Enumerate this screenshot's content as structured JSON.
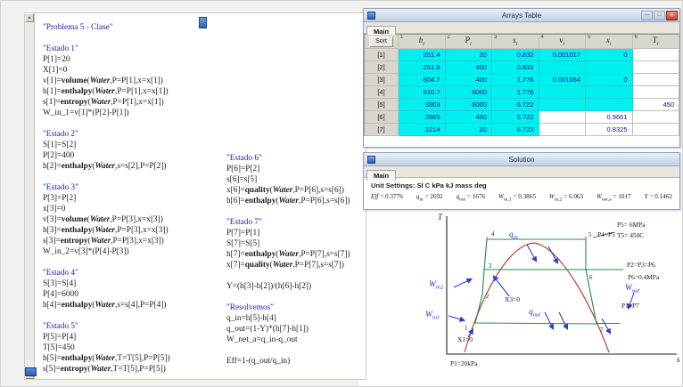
{
  "colors": {
    "cyan_cell": "#00efef",
    "titlebar": "#c3d0e2",
    "comment_text": "#2121b4",
    "value_text": "#10108e",
    "dome_red": "#c6403c",
    "cycle_green": "#1f8a4c",
    "annotation_blue": "#2b3fd4",
    "close_button": "#c73d2c"
  },
  "equations": {
    "bold_words": [
      "volume",
      "enthalpy",
      "entropy",
      "quality"
    ],
    "bold_italic_words": [
      "Water"
    ],
    "column1": [
      "\"Problema 5 - Clase\"",
      "",
      "\"Estado 1\"",
      "P[1]=20",
      "X[1]=0",
      "v[1]=volume(Water,P=P[1],x=x[1])",
      "h[1]=enthalpy(Water,P=P[1],x=x[1])",
      "s[1]=entropy(Water,P=P[1],x=x[1])",
      "W_in_1=v[1]*(P[2]-P[1])",
      "",
      "\"Estado 2\"",
      "S[1]=S[2]",
      "P[2]=400",
      "h[2]=enthalpy(Water,s=s[2],P=P[2])",
      "",
      "\"Estado 3\"",
      "P[3]=P[2]",
      "x[3]=0",
      "v[3]=volume(Water,P=P[3],x=x[3])",
      "h[3]=enthalpy(Water,P=P[3],x=x[3])",
      "s[3]=entropy(Water,P=P[3],x=x[3])",
      "W_in_2=v[3]*(P[4]-P[3])",
      "",
      "\"Estado 4\"",
      "S[3]=S[4]",
      "P[4]=6000",
      "h[4]=enthalpy(Water,s=s[4],P=P[4])",
      "",
      "\"Estado 5\"",
      "P[5]=P[4]",
      "T[5]=450",
      "h[5]=enthalpy(Water,T=T[5],P=P[5])",
      "s[5]=entropy(Water,T=T[5],P=P[5])"
    ],
    "column2": [
      "\"Estado 6\"",
      "P[6]=P[2]",
      "s[6]=s[5]",
      "x[6]=quality(Water,P=P[6],s=s[6])",
      "h[6]=enthalpy(Water,P=P[6],s=s[6])",
      "",
      "\"Estado 7\"",
      "P[7]=P[1]",
      "S[7]=S[5]",
      "h[7]=enthalpy(Water,P=P[7],s=s[7])",
      "x[7]=quality(Water,P=P[7],s=s[7])",
      "",
      "Y=(h[3]-h[2])/(h[6]-h[2])",
      "",
      "\"Resolvemos\"",
      "q_in=h[5]-h[4]",
      "q_out=(1-Y)*(h[7]-h[1])",
      "W_net_a=q_in-q_out",
      "",
      "Eff=1-(q_out/q_in)"
    ]
  },
  "arrays_table": {
    "title": "Arrays Table",
    "tab": "Main",
    "sort_label": "Sort",
    "columns": [
      {
        "num": "1",
        "base": "h",
        "sub": "i"
      },
      {
        "num": "2",
        "base": "P",
        "sub": "i"
      },
      {
        "num": "3",
        "base": "s",
        "sub": "i"
      },
      {
        "num": "4",
        "base": "v",
        "sub": "i"
      },
      {
        "num": "5",
        "base": "x",
        "sub": "i"
      },
      {
        "num": "6",
        "base": "T",
        "sub": "i"
      }
    ],
    "rows": [
      {
        "label": "[1]",
        "cells": [
          {
            "v": "251.4",
            "c": true
          },
          {
            "v": "20",
            "c": true
          },
          {
            "v": "0.832",
            "c": true
          },
          {
            "v": "0.001017",
            "c": true
          },
          {
            "v": "0",
            "c": true
          },
          {
            "v": "",
            "c": false
          }
        ]
      },
      {
        "label": "[2]",
        "cells": [
          {
            "v": "251.8",
            "c": true
          },
          {
            "v": "400",
            "c": true
          },
          {
            "v": "0.832",
            "c": true
          },
          {
            "v": "",
            "c": true
          },
          {
            "v": "",
            "c": true
          },
          {
            "v": "",
            "c": false
          }
        ]
      },
      {
        "label": "[3]",
        "cells": [
          {
            "v": "604.7",
            "c": true
          },
          {
            "v": "400",
            "c": true
          },
          {
            "v": "1.776",
            "c": true
          },
          {
            "v": "0.001084",
            "c": true
          },
          {
            "v": "0",
            "c": true
          },
          {
            "v": "",
            "c": false
          }
        ]
      },
      {
        "label": "[4]",
        "cells": [
          {
            "v": "610.7",
            "c": true
          },
          {
            "v": "6000",
            "c": true
          },
          {
            "v": "1.776",
            "c": true
          },
          {
            "v": "",
            "c": true
          },
          {
            "v": "",
            "c": true
          },
          {
            "v": "",
            "c": false
          }
        ]
      },
      {
        "label": "[5]",
        "cells": [
          {
            "v": "3303",
            "c": true
          },
          {
            "v": "6000",
            "c": true
          },
          {
            "v": "6.722",
            "c": true
          },
          {
            "v": "",
            "c": true
          },
          {
            "v": "",
            "c": true
          },
          {
            "v": "450",
            "c": false
          }
        ]
      },
      {
        "label": "[6]",
        "cells": [
          {
            "v": "2665",
            "c": true
          },
          {
            "v": "400",
            "c": true
          },
          {
            "v": "6.722",
            "c": true
          },
          {
            "v": "",
            "c": false
          },
          {
            "v": "0.9661",
            "c": false
          },
          {
            "v": "",
            "c": false
          }
        ]
      },
      {
        "label": "[7]",
        "cells": [
          {
            "v": "2214",
            "c": true
          },
          {
            "v": "20",
            "c": true
          },
          {
            "v": "6.722",
            "c": true
          },
          {
            "v": "",
            "c": false
          },
          {
            "v": "0.8325",
            "c": false
          },
          {
            "v": "",
            "c": false
          }
        ]
      }
    ]
  },
  "solution": {
    "title": "Solution",
    "tab": "Main",
    "unit_settings": "Unit Settings: SI C kPa kJ mass deg",
    "items": [
      {
        "name": "Eff",
        "sub": "",
        "value": "0.3776"
      },
      {
        "name": "q",
        "sub": "in",
        "value": "2692"
      },
      {
        "name": "q",
        "sub": "out",
        "value": "1676"
      },
      {
        "name": "W",
        "sub": "in,1",
        "value": "0.3865"
      },
      {
        "name": "W",
        "sub": "in,2",
        "value": "6.063"
      },
      {
        "name": "W",
        "sub": "net,a",
        "value": "1017"
      },
      {
        "name": "Y",
        "sub": "",
        "value": "0.1462"
      }
    ]
  },
  "diagram": {
    "t_label": "T",
    "s_label": "s",
    "flows": {
      "q_in": {
        "base": "q",
        "sub": "in"
      },
      "q_out": {
        "base": "q",
        "sub": "out"
      },
      "w_in1": {
        "base": "W",
        "sub": "in1"
      },
      "w_in2": {
        "base": "W",
        "sub": "in2"
      },
      "w_out": {
        "base": "W",
        "sub": "out"
      }
    },
    "points": {
      "p1": "1",
      "p2": "2",
      "p3": "3",
      "p4": "4",
      "p5": "5",
      "p6": "6",
      "p7": "7"
    },
    "annotations": {
      "p4p5": "P4=P5",
      "p5_pressure": "P5= 6MPa",
      "t5_temp": "T5= 450C",
      "p2p3p6": "P2=P3=P6",
      "p6_pressure": "P6=0.4MPa",
      "p1p7": "P1=P7",
      "x3": "X3=0",
      "x1": "X1=0",
      "p1_pressure": "P1=20kPa"
    }
  }
}
